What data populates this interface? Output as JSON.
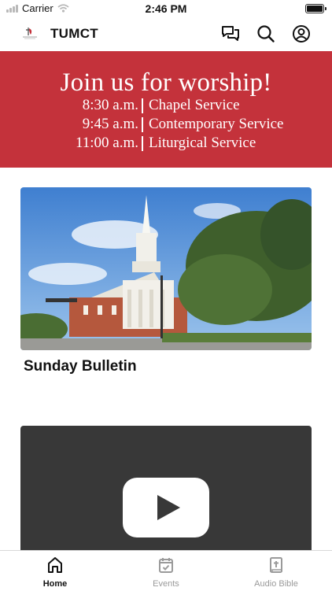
{
  "status_bar": {
    "carrier": "Carrier",
    "time": "2:46 PM"
  },
  "header": {
    "title": "TUMCT",
    "icons": [
      "chat-icon",
      "search-icon",
      "profile-icon"
    ]
  },
  "banner": {
    "headline": "Join us for worship!",
    "services": [
      {
        "time": "8:30 a.m.",
        "name": "Chapel Service"
      },
      {
        "time": "9:45 a.m.",
        "name": "Contemporary Service"
      },
      {
        "time": "11:00 a.m.",
        "name": "Liturgical Service"
      }
    ],
    "color": "#c4323b"
  },
  "cards": [
    {
      "title": "Sunday Bulletin"
    },
    {
      "title": "",
      "media": "video-player"
    }
  ],
  "tabs": [
    {
      "label": "Home",
      "icon": "home-icon",
      "active": true
    },
    {
      "label": "Events",
      "icon": "calendar-icon",
      "active": false
    },
    {
      "label": "Audio Bible",
      "icon": "bible-icon",
      "active": false
    }
  ],
  "colors": {
    "active_tab": "#111111",
    "inactive_tab": "#9a9a9a",
    "video_bg": "#383838"
  }
}
